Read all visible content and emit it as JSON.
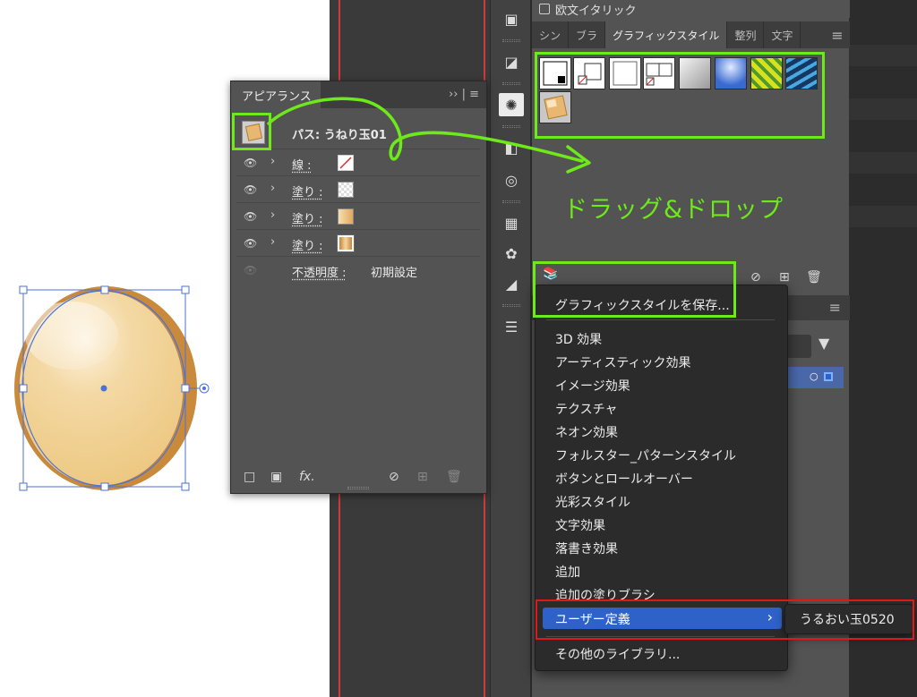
{
  "gs_panel": {
    "checkbox_label": "欧文イタリック",
    "tabs": [
      "シン",
      "ブラ",
      "グラフィックスタイル",
      "整列",
      "文字"
    ],
    "active_tab": "グラフィックスタイル"
  },
  "appearance_panel": {
    "tab_label": "アピアランス",
    "header_arrows": "›› | ≡",
    "path_label": "パス: うねり玉01",
    "rows": [
      {
        "label": "線 :"
      },
      {
        "label": "塗り :"
      },
      {
        "label": "塗り :"
      },
      {
        "label": "塗り :"
      }
    ],
    "opacity_label": "不透明度 :",
    "opacity_value": "初期設定",
    "fx_label": "fx."
  },
  "context_menu": {
    "save_item": "グラフィックスタイルを保存...",
    "items": [
      "3D 効果",
      "アーティスティック効果",
      "イメージ効果",
      "テクスチャ",
      "ネオン効果",
      "フォルスター_パターンスタイル",
      "ボタンとロールオーバー",
      "光彩スタイル",
      "文字効果",
      "落書き効果",
      "追加",
      "追加の塗りブラシ"
    ],
    "user_defined": "ユーザー定義",
    "other_libraries": "その他のライブラリ..."
  },
  "submenu": {
    "item": "うるおい玉0520"
  },
  "annotation": {
    "drag_drop": "ドラッグ&ドロップ"
  },
  "colors": {
    "accent_green": "#6eea1a",
    "highlight_red": "#e01818",
    "menu_selected": "#2f62c9",
    "egg_fill": "#efc980",
    "egg_shadow": "#c98a3c",
    "selection_blue": "#4a72d8"
  }
}
